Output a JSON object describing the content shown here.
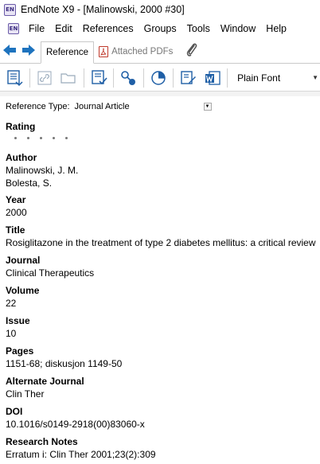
{
  "window": {
    "logo": "EN",
    "title": "EndNote X9 - [Malinowski, 2000 #30]"
  },
  "menu": {
    "logo": "EN",
    "items": [
      "File",
      "Edit",
      "References",
      "Groups",
      "Tools",
      "Window",
      "Help"
    ]
  },
  "tabs": {
    "reference": "Reference",
    "attached_pdfs": "Attached PDFs"
  },
  "toolbar": {
    "font": "Plain Font"
  },
  "reference": {
    "type_label": "Reference Type:",
    "type_value": "Journal Article",
    "rating_label": "Rating",
    "rating_value": 0,
    "rating_max": 5,
    "author_label": "Author",
    "authors": [
      "Malinowski, J. M.",
      "Bolesta, S."
    ],
    "year_label": "Year",
    "year": "2000",
    "title_label": "Title",
    "title": "Rosiglitazone in the treatment of type 2 diabetes mellitus: a critical review",
    "journal_label": "Journal",
    "journal": "Clinical Therapeutics",
    "volume_label": "Volume",
    "volume": "22",
    "issue_label": "Issue",
    "issue": "10",
    "pages_label": "Pages",
    "pages": "1151-68; diskusjon 1149-50",
    "alt_journal_label": "Alternate Journal",
    "alt_journal": "Clin Ther",
    "doi_label": "DOI",
    "doi": "10.1016/s0149-2918(00)83060-x",
    "research_notes_label": "Research Notes",
    "research_notes": "Erratum i: Clin Ther 2001;23(2):309"
  },
  "colors": {
    "nav_arrow": "#1e73be",
    "pdf_red": "#c0392b",
    "icon_blue": "#1f5fa6"
  }
}
